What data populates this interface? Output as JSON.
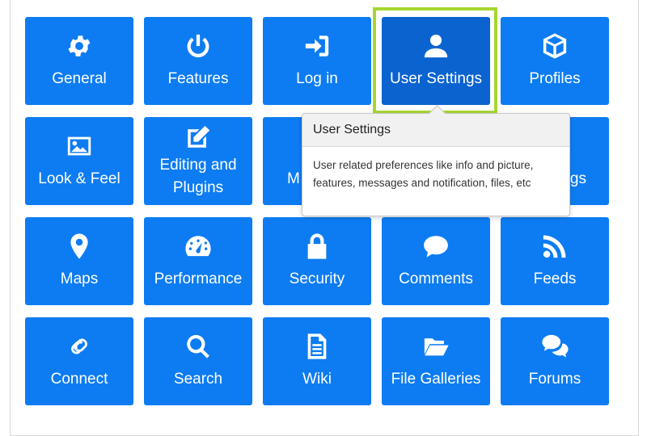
{
  "tiles": [
    {
      "label": "General",
      "icon": "gear-icon"
    },
    {
      "label": "Features",
      "icon": "power-icon"
    },
    {
      "label": "Log in",
      "icon": "sign-in-icon"
    },
    {
      "label": "User Settings",
      "icon": "user-icon"
    },
    {
      "label": "Profiles",
      "icon": "cube-icon"
    },
    {
      "label": "Look & Feel",
      "icon": "image-icon"
    },
    {
      "label": "Editing and Plugins",
      "icon": "edit-icon"
    },
    {
      "label": "M",
      "icon": "hidden-icon"
    },
    {
      "label": "",
      "icon": "hidden-icon"
    },
    {
      "label": "ags",
      "icon": "hidden-icon"
    },
    {
      "label": "Maps",
      "icon": "map-marker-icon"
    },
    {
      "label": "Performance",
      "icon": "gauge-icon"
    },
    {
      "label": "Security",
      "icon": "lock-icon"
    },
    {
      "label": "Comments",
      "icon": "comment-icon"
    },
    {
      "label": "Feeds",
      "icon": "rss-icon"
    },
    {
      "label": "Connect",
      "icon": "link-icon"
    },
    {
      "label": "Search",
      "icon": "search-icon"
    },
    {
      "label": "Wiki",
      "icon": "file-text-icon"
    },
    {
      "label": "File Galleries",
      "icon": "folder-open-icon"
    },
    {
      "label": "Forums",
      "icon": "comments-icon"
    }
  ],
  "tooltip": {
    "title": "User Settings",
    "body": "User related preferences like info and picture, features, messages and notification, files, etc"
  },
  "colors": {
    "tile": "#0d7cf2",
    "tile_active": "#0a63cf",
    "highlight": "#a6d630"
  }
}
